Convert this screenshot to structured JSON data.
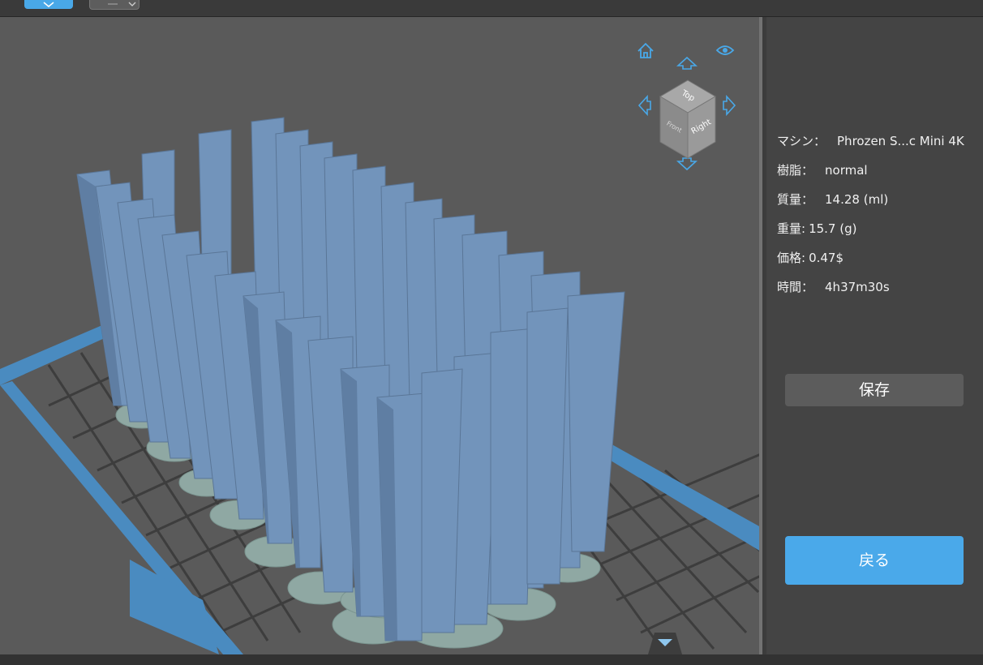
{
  "toolbar": {
    "tabs": [
      {
        "name": "active-tab",
        "icon": "tool-icon"
      },
      {
        "name": "view-select",
        "icon": "chevron-down-icon"
      }
    ]
  },
  "view_cube": {
    "faces": {
      "top": "Top",
      "front": "Front",
      "right": "Right"
    },
    "icons": [
      "home-icon",
      "eye-icon",
      "arrow-up-icon",
      "arrow-left-icon",
      "arrow-right-icon",
      "arrow-down-icon"
    ]
  },
  "info": {
    "machine_label": "マシン：",
    "machine_value": "Phrozen S...c Mini 4K",
    "resin_label": "樹脂：",
    "resin_value": "normal",
    "volume_label": "質量：",
    "volume_value": "14.28  (ml)",
    "weight_label": "重量:",
    "weight_value": "15.7  (g)",
    "price_label": "価格:",
    "price_value": "0.47$",
    "time_label": "時間：",
    "time_value": "4h37m30s"
  },
  "buttons": {
    "save": "保存",
    "back": "戻る"
  },
  "colors": {
    "accent": "#49a8e8",
    "model": "#6f8eb3",
    "plate_border": "#4a8bc0",
    "grid": "#3e3e3e",
    "supports": "#8fa8a3"
  }
}
